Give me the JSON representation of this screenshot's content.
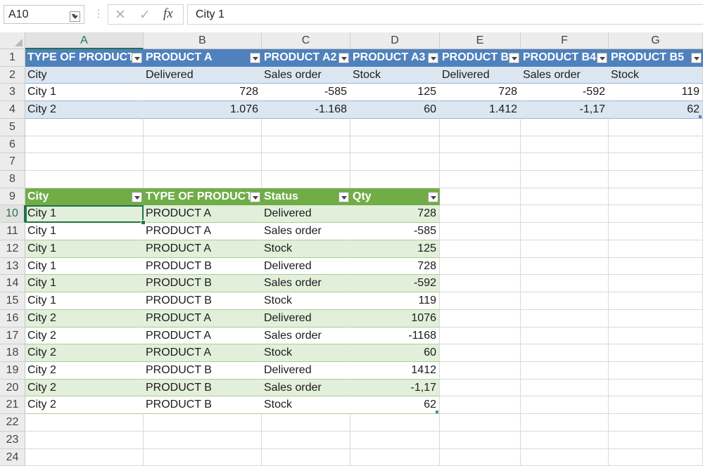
{
  "formula_bar": {
    "name_box": "A10",
    "dots": "⋮",
    "cancel_glyph": "✕",
    "enter_glyph": "✓",
    "fx_label": "fx",
    "formula": "City 1"
  },
  "columns": [
    "A",
    "B",
    "C",
    "D",
    "E",
    "F",
    "G"
  ],
  "rows": [
    "1",
    "2",
    "3",
    "4",
    "5",
    "6",
    "7",
    "8",
    "9",
    "10",
    "11",
    "12",
    "13",
    "14",
    "15",
    "16",
    "17",
    "18",
    "19",
    "20",
    "21",
    "22",
    "23",
    "24"
  ],
  "table1": {
    "headers": [
      "TYPE OF PRODUCT",
      "PRODUCT A",
      "PRODUCT A2",
      "PRODUCT A3",
      "PRODUCT B",
      "PRODUCT B4",
      "PRODUCT B5"
    ],
    "rows": [
      [
        "City",
        "Delivered",
        "Sales order",
        "Stock",
        "Delivered",
        "Sales order",
        "Stock"
      ],
      [
        "City 1",
        "728",
        "-585",
        "125",
        "728",
        "-592",
        "119"
      ],
      [
        "City 2",
        "1.076",
        "-1.168",
        "60",
        "1.412",
        "-1,17",
        "62"
      ]
    ]
  },
  "table2": {
    "headers": [
      "City",
      "TYPE OF PRODUCT",
      "Status",
      "Qty"
    ],
    "rows": [
      [
        "City 1",
        "PRODUCT A",
        "Delivered",
        "728"
      ],
      [
        "City 1",
        "PRODUCT A",
        "Sales order",
        "-585"
      ],
      [
        "City 1",
        "PRODUCT A",
        "Stock",
        "125"
      ],
      [
        "City 1",
        "PRODUCT B",
        "Delivered",
        "728"
      ],
      [
        "City 1",
        "PRODUCT B",
        "Sales order",
        "-592"
      ],
      [
        "City 1",
        "PRODUCT B",
        "Stock",
        "119"
      ],
      [
        "City 2",
        "PRODUCT A",
        "Delivered",
        "1076"
      ],
      [
        "City 2",
        "PRODUCT A",
        "Sales order",
        "-1168"
      ],
      [
        "City 2",
        "PRODUCT A",
        "Stock",
        "60"
      ],
      [
        "City 2",
        "PRODUCT B",
        "Delivered",
        "1412"
      ],
      [
        "City 2",
        "PRODUCT B",
        "Sales order",
        "-1,17"
      ],
      [
        "City 2",
        "PRODUCT B",
        "Stock",
        "62"
      ]
    ]
  },
  "colors": {
    "table1_header": "#4f81bd",
    "table1_band": "#dce6f1",
    "table2_header": "#70ad47",
    "table2_band": "#e2efda",
    "selection": "#217346"
  }
}
